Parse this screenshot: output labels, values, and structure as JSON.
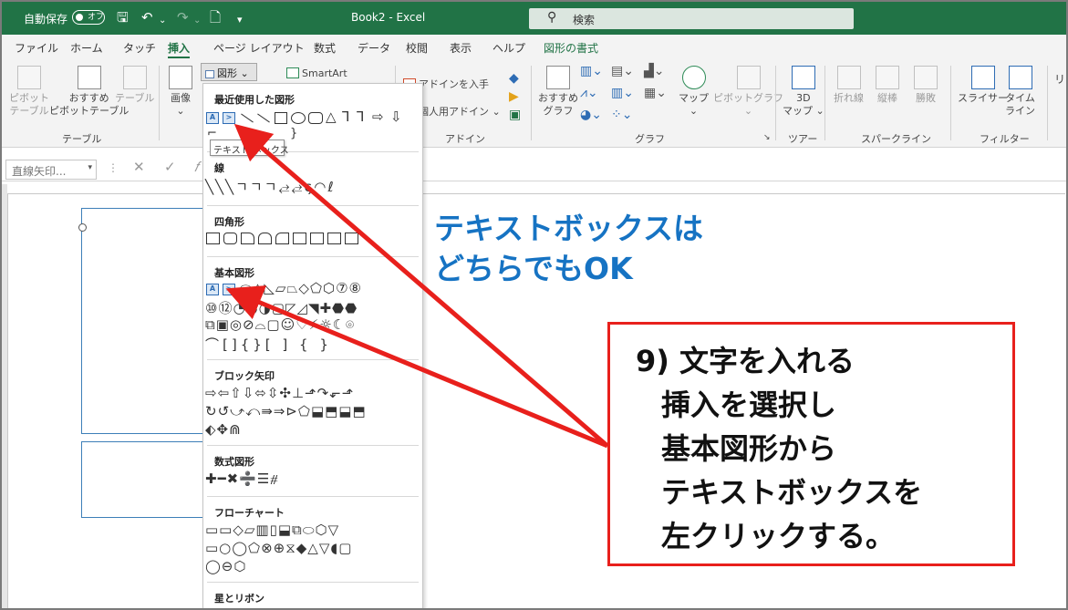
{
  "titlebar": {
    "autosave_label": "自動保存",
    "autosave_state": "オフ",
    "window_title": "Book2  -  Excel",
    "search_placeholder": "検索"
  },
  "tabs": [
    "ファイル",
    "ホーム",
    "タッチ",
    "挿入",
    "ページ レイアウト",
    "数式",
    "データ",
    "校閲",
    "表示",
    "ヘルプ",
    "図形の書式"
  ],
  "active_tab": "挿入",
  "ribbon": {
    "pivot": "ピボット\nテーブル",
    "recommended_pivot": "おすすめ\nピボットテーブル",
    "table": "テーブル",
    "group_table": "テーブル",
    "image": "画像",
    "shapes": "図形",
    "smartart": "SmartArt",
    "get_addins": "アドインを入手",
    "my_addins": "個人用アドイン",
    "group_addin": "アドイン",
    "recommended_chart": "おすすめ\nグラフ",
    "map": "マップ",
    "pivot_chart": "ピボットグラフ",
    "group_chart": "グラフ",
    "map3d": "3D\nマップ",
    "group_tour": "ツアー",
    "line": "折れ線",
    "column": "縦棒",
    "winloss": "勝敗",
    "group_sparkline": "スパークライン",
    "slicer": "スライサー",
    "timeline": "タイム\nライン",
    "group_filter": "フィルター"
  },
  "formulabar": {
    "namebox": "直線矢印..."
  },
  "gallery": {
    "recent": "最近使用した図形",
    "tooltip": "テキスト ボックス",
    "lines": "線",
    "rectangles": "四角形",
    "basic": "基本図形",
    "block_arrows": "ブロック矢印",
    "equation": "数式図形",
    "flowchart": "フローチャート",
    "stars": "星とリボン"
  },
  "annotations": {
    "blue_line1": "テキストボックスは",
    "blue_line2": "どちらでもOK",
    "callout_lines": [
      "9) 文字を入れる",
      "挿入を選択し",
      "基本図形から",
      "テキストボックスを",
      "左クリックする。"
    ]
  },
  "colors": {
    "excel_green": "#217346",
    "callout_red": "#e8201c",
    "note_blue": "#1673c3"
  }
}
